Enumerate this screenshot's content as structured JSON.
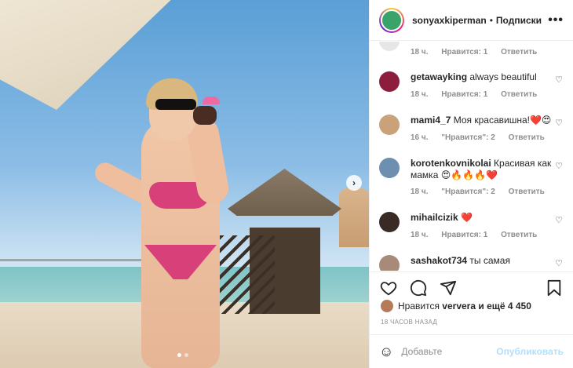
{
  "header": {
    "username": "sonyaxkiperman",
    "separator": "•",
    "follow_label": "Подписки",
    "more_label": "•••"
  },
  "comments": [
    {
      "username": "",
      "text": "",
      "time": "18 ч.",
      "likes": "Нравится: 1",
      "reply": "Ответить",
      "avatar_color": "#e6e6e6"
    },
    {
      "username": "getawayking",
      "text": "always beautiful",
      "time": "18 ч.",
      "likes": "Нравится: 1",
      "reply": "Ответить",
      "avatar_color": "#8c1d3c"
    },
    {
      "username": "mami4_7",
      "text": "Моя красавишна!❤️😍",
      "time": "16 ч.",
      "likes": "\"Нравится\": 2",
      "reply": "Ответить",
      "avatar_color": "#c9a27a"
    },
    {
      "username": "korotenkovnikolai",
      "text": "Красивая как мамка 😍🔥🔥🔥❤️",
      "time": "18 ч.",
      "likes": "\"Нравится\": 2",
      "reply": "Ответить",
      "avatar_color": "#6f8fb0"
    },
    {
      "username": "mihailcizik",
      "text": "❤️",
      "time": "18 ч.",
      "likes": "Нравится: 1",
      "reply": "Ответить",
      "avatar_color": "#3a2a26"
    },
    {
      "username": "sashakot734",
      "text": "ты самая",
      "time": "",
      "likes": "",
      "reply": "",
      "avatar_color": "#a88a7a"
    }
  ],
  "likes": {
    "prefix": "Нравится",
    "user": "ververa",
    "suffix": "и ещё 4 450"
  },
  "time_ago": "18 ЧАСОВ НАЗАД",
  "comment_input": {
    "placeholder": "Добавьте",
    "publish_label": "Опубликовать"
  },
  "icons": {
    "heart": "heart-icon",
    "comment": "comment-icon",
    "share": "share-icon",
    "bookmark": "bookmark-icon",
    "smile": "smile-icon",
    "next": "chevron-right-icon"
  },
  "carousel": {
    "total": 2,
    "active": 1
  }
}
